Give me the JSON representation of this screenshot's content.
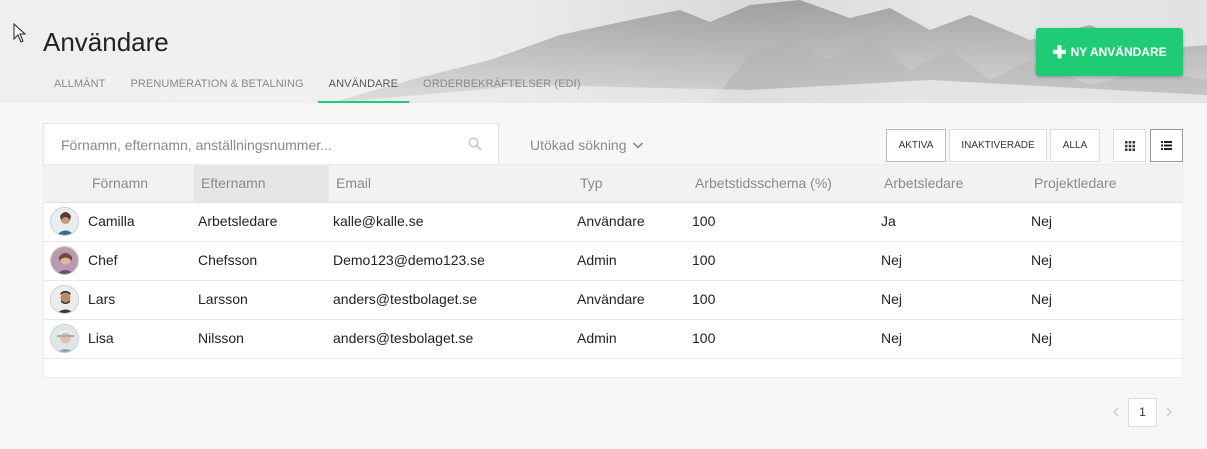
{
  "page": {
    "title": "Användare"
  },
  "tabs": [
    {
      "label": "ALLMÄNT"
    },
    {
      "label": "PRENUMERATION & BETALNING"
    },
    {
      "label": "ANVÄNDARE"
    },
    {
      "label": "ORDERBEKRÄFTELSER (EDI)"
    }
  ],
  "active_tab": "ANVÄNDARE",
  "new_user_button": {
    "label": "NY ANVÄNDARE",
    "icon": "plus-icon",
    "color": "#1fcc75"
  },
  "search": {
    "placeholder": "Förnamn, efternamn, anställningsnummer...",
    "value": "",
    "icon": "search-icon"
  },
  "advanced_search": {
    "label": "Utökad sökning",
    "icon": "chevron-down-icon"
  },
  "filters": [
    {
      "label": "AKTIVA",
      "active": true
    },
    {
      "label": "INAKTIVERADE",
      "active": false
    },
    {
      "label": "ALLA",
      "active": false
    }
  ],
  "view_toggles": [
    {
      "icon": "grid-icon",
      "active": false
    },
    {
      "icon": "list-icon",
      "active": true
    }
  ],
  "table": {
    "columns": [
      "Förnamn",
      "Efternamn",
      "Email",
      "Typ",
      "Arbetstidsschema (%)",
      "Arbetsledare",
      "Projektledare"
    ],
    "sorted_column": "Efternamn",
    "rows": [
      {
        "first": "Camilla",
        "last": "Arbetsledare",
        "email": "kalle@kalle.se",
        "type": "Användare",
        "schedule": "100",
        "supervisor": "Ja",
        "project_lead": "Nej"
      },
      {
        "first": "Chef",
        "last": "Chefsson",
        "email": "Demo123@demo123.se",
        "type": "Admin",
        "schedule": "100",
        "supervisor": "Nej",
        "project_lead": "Nej"
      },
      {
        "first": "Lars",
        "last": "Larsson",
        "email": "anders@testbolaget.se",
        "type": "Användare",
        "schedule": "100",
        "supervisor": "Nej",
        "project_lead": "Nej"
      },
      {
        "first": "Lisa",
        "last": "Nilsson",
        "email": "anders@tesbolaget.se",
        "type": "Admin",
        "schedule": "100",
        "supervisor": "Nej",
        "project_lead": "Nej"
      }
    ]
  },
  "pagination": {
    "current_page": "1"
  }
}
